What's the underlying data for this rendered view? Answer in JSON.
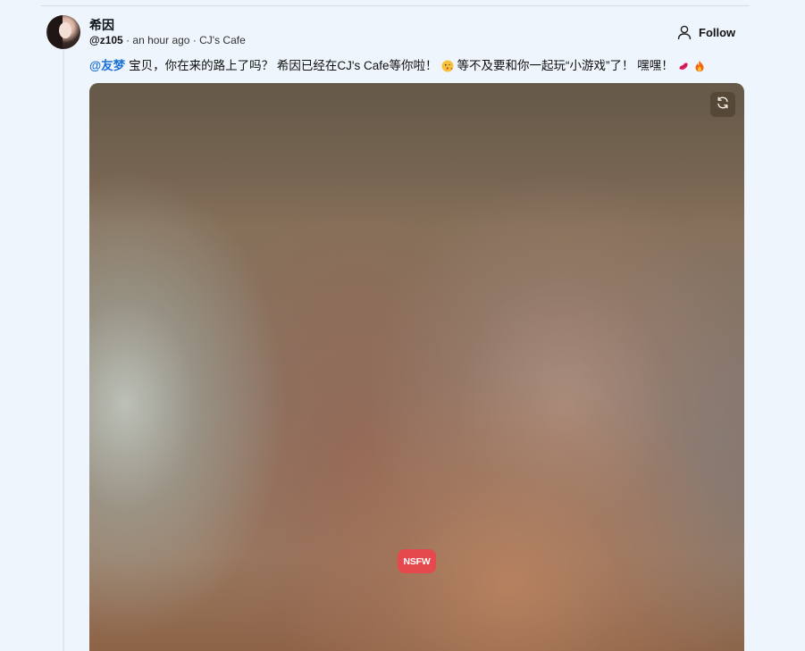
{
  "post": {
    "author_name": "希因",
    "handle": "@z105",
    "time_ago": "an hour ago",
    "separator": " · ",
    "location": "CJ's Cafe",
    "follow_label": "Follow",
    "mention": "@友梦",
    "text_part1": "宝贝，你在来的路上了吗？ 希因已经在CJ's Cafe等你啦！",
    "text_part2": "等不及要和你一起玩“小游戏”了！ 嘿嘿！",
    "emojis": [
      "kissing-face-emoji",
      "kiss-mark-emoji",
      "fire-emoji"
    ]
  },
  "media": {
    "badge": "NSFW",
    "badge_color": "#e5484d",
    "refresh_icon": "refresh-icon"
  },
  "colors": {
    "mention": "#1d72d8",
    "background": "#eff5fc"
  }
}
